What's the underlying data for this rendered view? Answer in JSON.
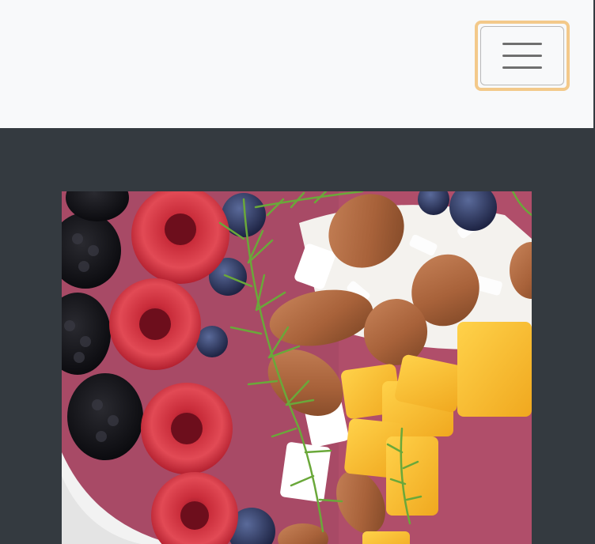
{
  "navbar": {
    "background": "#f8f9fa",
    "toggler": {
      "icon": "hamburger-menu-icon",
      "focus_ring_color": "#f3c98a"
    }
  },
  "main": {
    "background": "#343a40",
    "image": {
      "subject": "fruit-bowl-photo"
    }
  }
}
